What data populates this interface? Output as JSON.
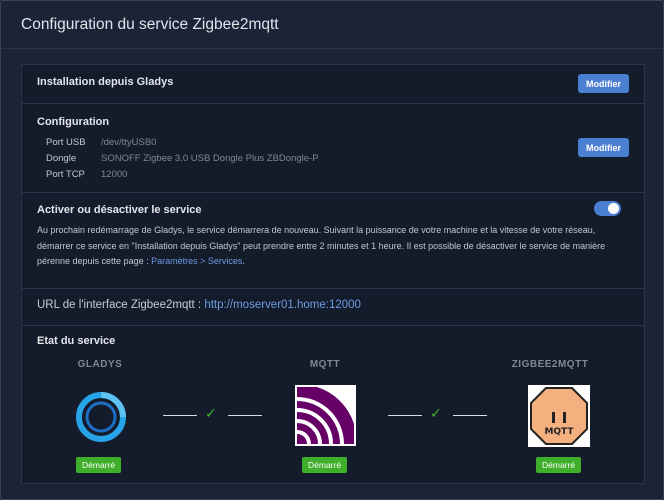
{
  "header": {
    "title": "Configuration du service Zigbee2mqtt"
  },
  "installation": {
    "title": "Installation depuis Gladys",
    "button": "Modifier"
  },
  "configuration": {
    "title": "Configuration",
    "rows": [
      {
        "label": "Port USB",
        "value": "/dev/ttyUSB0"
      },
      {
        "label": "Dongle",
        "value": "SONOFF Zigbee 3.0 USB Dongle Plus ZBDongle-P"
      },
      {
        "label": "Port TCP",
        "value": "12000"
      }
    ],
    "button": "Modifier"
  },
  "activation": {
    "title": "Activer ou désactiver le service",
    "description": "Au prochain redémarrage de Gladys, le service démarrera de nouveau. Suivant la puissance de votre machine et la vitesse de votre réseau, démarrer ce service en \"Installation depuis Gladys\" peut prendre entre 2 minutes et 1 heure. Il est possible de désactiver le service de manière pérenne depuis cette page : ",
    "link": "Paramètres > Services",
    "end": ".",
    "enabled": true
  },
  "url": {
    "label": "URL de l'interface Zigbee2mqtt : ",
    "value": "http://moserver01.home:12000"
  },
  "status": {
    "title": "Etat du service",
    "services": [
      {
        "name": "GLADYS",
        "badge": "Démarré",
        "icon": "gladys-logo-icon"
      },
      {
        "name": "MQTT",
        "badge": "Démarré",
        "icon": "mqtt-logo-icon"
      },
      {
        "name": "ZIGBEE2MQTT",
        "badge": "Démarré",
        "icon": "zigbee2mqtt-logo-icon"
      }
    ],
    "zigbee_logo_text": "MQTT",
    "colors": {
      "ok": "#43b32b",
      "badge": "#3fae2a",
      "accent": "#4a7fd4"
    }
  }
}
